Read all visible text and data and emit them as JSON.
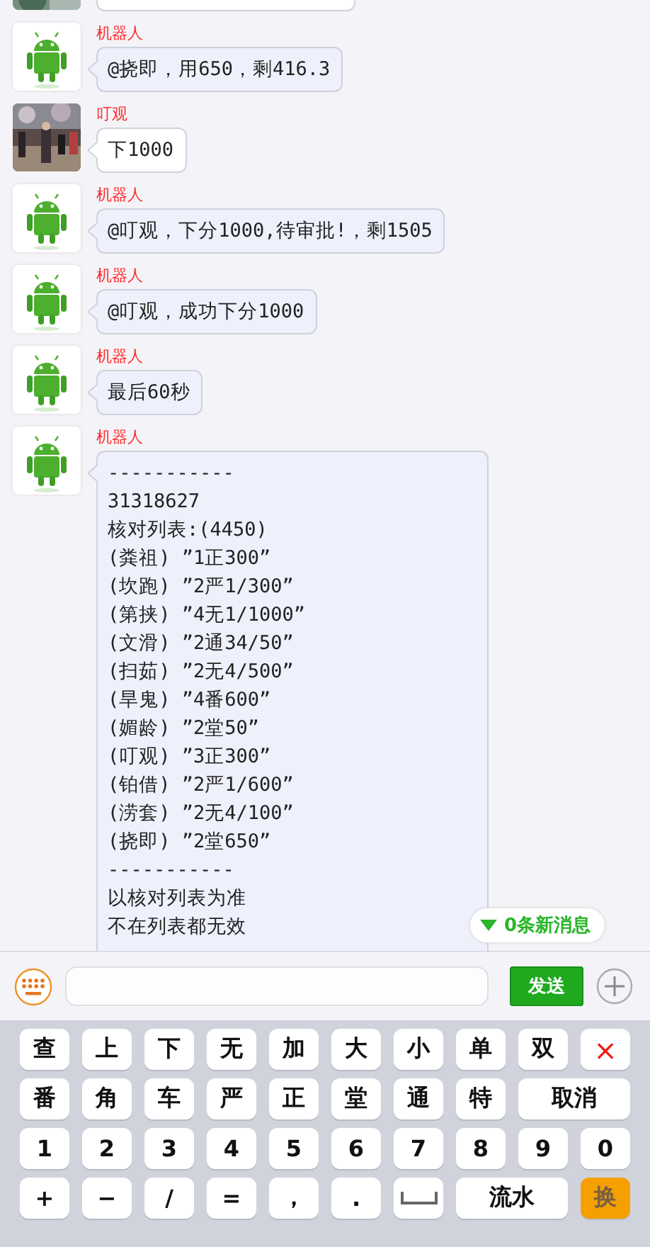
{
  "messages": [
    {
      "kind": "human"
    },
    {
      "kind": "robot",
      "sender": "机器人",
      "lines": [
        "@挠即，用650，剩416.3"
      ]
    },
    {
      "kind": "human",
      "sender": "叮观",
      "lines": [
        "下1000"
      ]
    },
    {
      "kind": "robot",
      "sender": "机器人",
      "lines": [
        "@叮观，下分1000,待审批!，剩1505"
      ]
    },
    {
      "kind": "robot",
      "sender": "机器人",
      "lines": [
        "@叮观，成功下分1000"
      ]
    },
    {
      "kind": "robot",
      "sender": "机器人",
      "lines": [
        "最后60秒"
      ]
    },
    {
      "kind": "robot",
      "sender": "机器人",
      "lines": [
        "-----------",
        "31318627",
        "核对列表:(4450)",
        "(粪祖) ”1正300”",
        "(坎跑) ”2严1/300”",
        "(第挟) ”4无1/1000”",
        "(文滑) ”2通34/50”",
        "(扫茹) ”2无4/500”",
        "(旱鬼) ”4番600”",
        "(媚龄) ”2堂50”",
        "(叮观) ”3正300”",
        "(铂借) ”2严1/600”",
        "(涝套) ”2无4/100”",
        "(挠即) ”2堂650”",
        "-----------",
        "以核对列表为准",
        "不在列表都无效"
      ]
    }
  ],
  "new_messages": "0条新消息",
  "input": {
    "send": "发送"
  },
  "keyboard": [
    [
      {
        "kind": "key",
        "label": "查"
      },
      {
        "kind": "key",
        "label": "上"
      },
      {
        "kind": "key",
        "label": "下"
      },
      {
        "kind": "key",
        "label": "无"
      },
      {
        "kind": "key",
        "label": "加"
      },
      {
        "kind": "key",
        "label": "大"
      },
      {
        "kind": "key",
        "label": "小"
      },
      {
        "kind": "key",
        "label": "单"
      },
      {
        "kind": "key",
        "label": "双"
      },
      {
        "kind": "delete",
        "label": "×"
      }
    ],
    [
      {
        "kind": "key",
        "label": "番"
      },
      {
        "kind": "key",
        "label": "角"
      },
      {
        "kind": "key",
        "label": "车"
      },
      {
        "kind": "key",
        "label": "严"
      },
      {
        "kind": "key",
        "label": "正"
      },
      {
        "kind": "key",
        "label": "堂"
      },
      {
        "kind": "key",
        "label": "通"
      },
      {
        "kind": "key",
        "label": "特"
      },
      {
        "kind": "wide",
        "label": "取消"
      }
    ],
    [
      {
        "kind": "key",
        "label": "1"
      },
      {
        "kind": "key",
        "label": "2"
      },
      {
        "kind": "key",
        "label": "3"
      },
      {
        "kind": "key",
        "label": "4"
      },
      {
        "kind": "key",
        "label": "5"
      },
      {
        "kind": "key",
        "label": "6"
      },
      {
        "kind": "key",
        "label": "7"
      },
      {
        "kind": "key",
        "label": "8"
      },
      {
        "kind": "key",
        "label": "9"
      },
      {
        "kind": "key",
        "label": "0"
      }
    ],
    [
      {
        "kind": "key",
        "label": "+"
      },
      {
        "kind": "key",
        "label": "−"
      },
      {
        "kind": "key",
        "label": "/"
      },
      {
        "kind": "key",
        "label": "="
      },
      {
        "kind": "key",
        "label": "，"
      },
      {
        "kind": "key",
        "label": "."
      },
      {
        "kind": "space"
      },
      {
        "kind": "wide",
        "label": "流水"
      },
      {
        "kind": "switch",
        "label": "换"
      }
    ]
  ]
}
